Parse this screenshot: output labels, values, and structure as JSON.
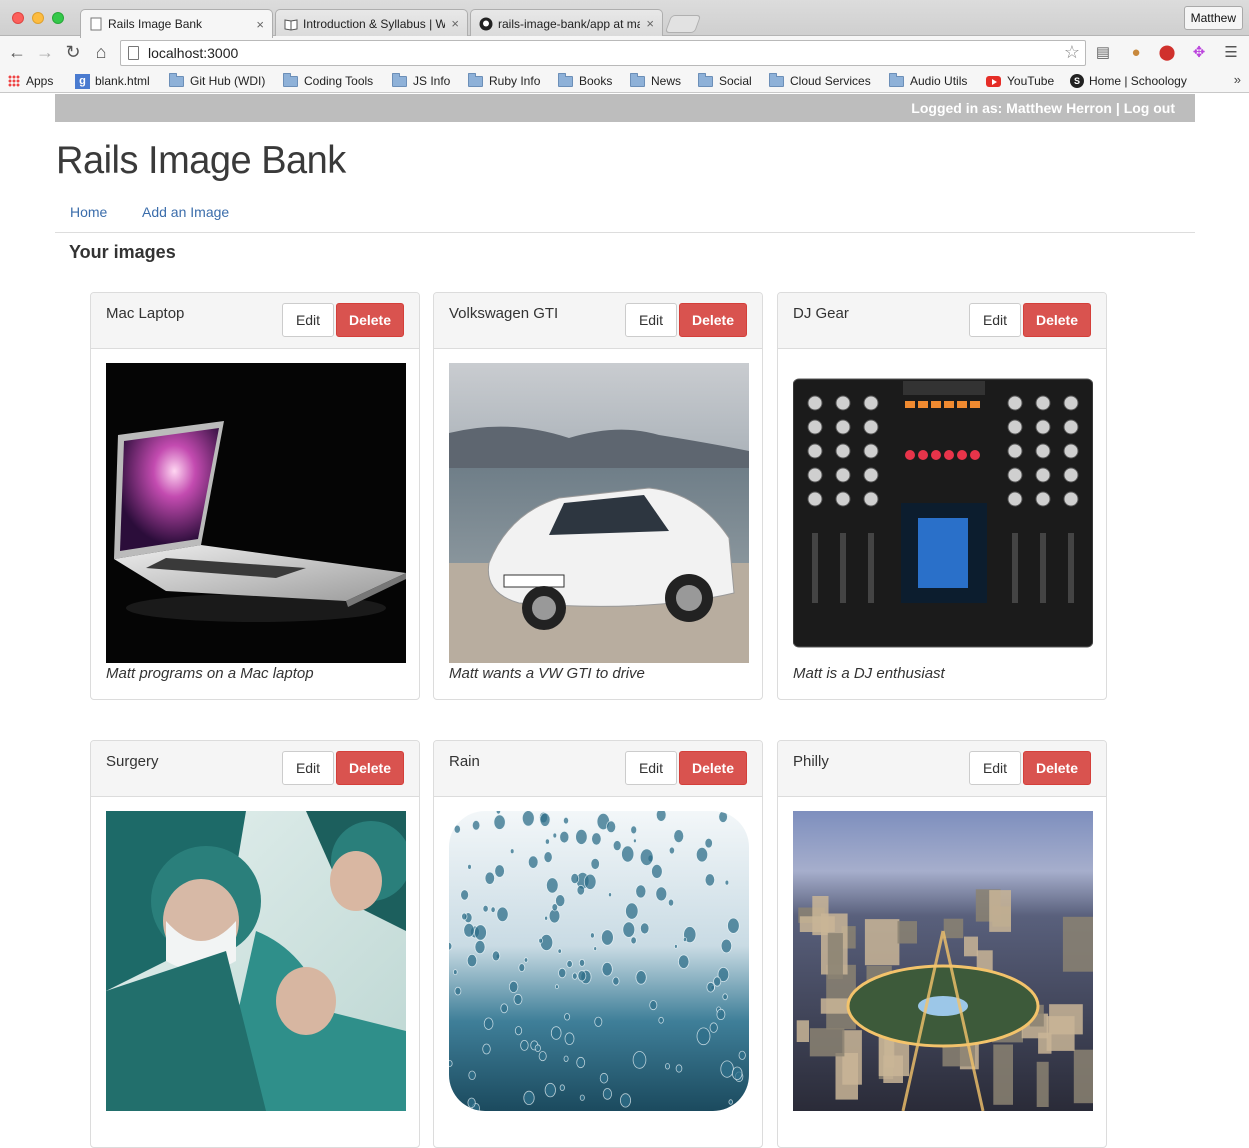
{
  "browser": {
    "tabs": [
      {
        "title": "Rails Image Bank",
        "close": "×"
      },
      {
        "title": "Introduction & Syllabus | W",
        "close": "×"
      },
      {
        "title": "rails-image-bank/app at ma",
        "close": "×"
      }
    ],
    "profile": "Matthew",
    "url": "localhost:3000",
    "bookmarks": [
      "Apps",
      "blank.html",
      "Git Hub (WDI)",
      "Coding Tools",
      "JS Info",
      "Ruby Info",
      "Books",
      "News",
      "Social",
      "Cloud Services",
      "Audio Utils",
      "YouTube",
      "Home | Schoology"
    ],
    "bookmarks_more": "»"
  },
  "header": {
    "logged_in_prefix": "Logged in as: Matthew Herron",
    "separator": " | ",
    "logout": "Log out"
  },
  "site": {
    "title": "Rails Image Bank",
    "nav": [
      "Home",
      "Add an Image"
    ],
    "section_heading": "Your images"
  },
  "buttons": {
    "edit": "Edit",
    "delete": "Delete"
  },
  "images": [
    {
      "title": "Mac Laptop",
      "caption": "Matt programs on a Mac laptop"
    },
    {
      "title": "Volkswagen GTI",
      "caption": "Matt wants a VW GTI to drive"
    },
    {
      "title": "DJ Gear",
      "caption": "Matt is a DJ enthusiast"
    },
    {
      "title": "Surgery",
      "caption": ""
    },
    {
      "title": "Rain",
      "caption": ""
    },
    {
      "title": "Philly",
      "caption": ""
    }
  ],
  "colors": {
    "delete_button": "#d9534f",
    "link": "#3b6dab",
    "userbar": "#bdbdbd"
  }
}
